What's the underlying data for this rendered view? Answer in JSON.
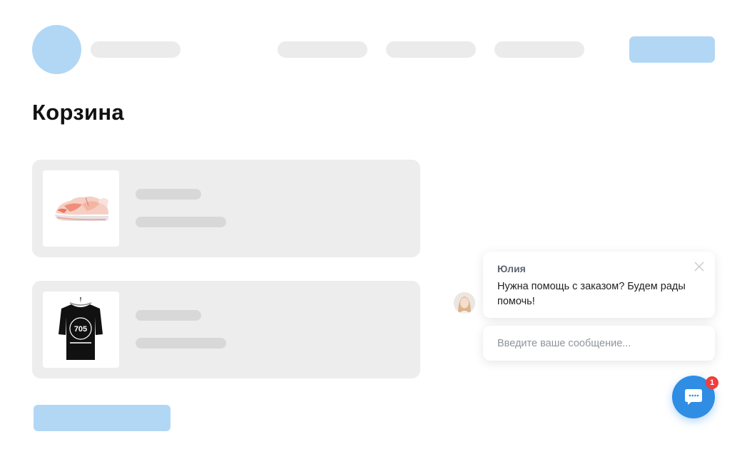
{
  "page": {
    "title": "Корзина"
  },
  "cart": {
    "items": [
      {
        "image": "sneaker-image"
      },
      {
        "image": "tshirt-image",
        "print_text": "705"
      }
    ]
  },
  "chat": {
    "agent_name": "Юлия",
    "message": "Нужна помощь с заказом? Будем рады помочь!",
    "input_placeholder": "Введите ваше сообщение...",
    "unread_count": "1",
    "accent_color": "#2f8de4",
    "badge_color": "#f23d3d"
  },
  "colors": {
    "placeholder_blue": "#b2d7f5",
    "placeholder_gray": "#ebebeb",
    "card_bg": "#ededed"
  }
}
